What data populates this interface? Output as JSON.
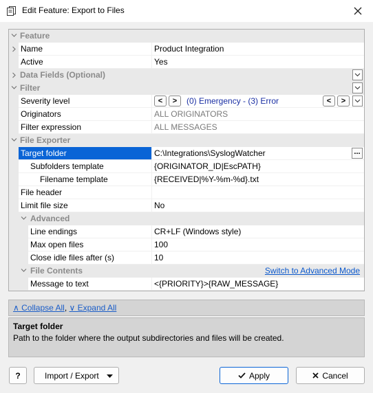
{
  "window": {
    "title": "Edit Feature: Export to Files"
  },
  "grid": {
    "cat_feature": "Feature",
    "name_label": "Name",
    "name_value": "Product Integration",
    "active_label": "Active",
    "active_value": "Yes",
    "cat_datafields": "Data Fields (Optional)",
    "cat_filter": "Filter",
    "severity_label": "Severity level",
    "severity_value": "(0) Emergency - (3) Error",
    "originators_label": "Originators",
    "originators_value": "ALL ORIGINATORS",
    "filterexpr_label": "Filter expression",
    "filterexpr_value": "ALL MESSAGES",
    "cat_fileexporter": "File Exporter",
    "target_label": "Target folder",
    "target_value": "C:\\Integrations\\SyslogWatcher",
    "subfolders_label": "Subfolders template",
    "subfolders_value": "{ORIGINATOR_ID|EscPATH}",
    "filename_label": "Filename template",
    "filename_value": "{RECEIVED|%Y-%m-%d}.txt",
    "fileheader_label": "File header",
    "fileheader_value": "",
    "limit_label": "Limit file size",
    "limit_value": "No",
    "cat_advanced": "Advanced",
    "lineendings_label": "Line endings",
    "lineendings_value": "CR+LF (Windows style)",
    "maxopen_label": "Max open files",
    "maxopen_value": "100",
    "closeidle_label": "Close idle files after (s)",
    "closeidle_value": "10",
    "cat_filecontents": "File Contents",
    "switch_link": "Switch to Advanced Mode",
    "msgtotext_label": "Message to text",
    "msgtotext_value": "<{PRIORITY}>{RAW_MESSAGE}",
    "ellipsis": "...",
    "nav_prev": "<",
    "nav_next": ">"
  },
  "expand_bar": {
    "collapse": "∧ Collapse All",
    "comma": ",",
    "expand": "∨ Expand All"
  },
  "description": {
    "title": "Target folder",
    "text": "Path to the folder where the output subdirectories and files will be created."
  },
  "footer": {
    "help": "?",
    "import_export": "Import / Export",
    "apply": "Apply",
    "cancel": "Cancel"
  },
  "colors": {
    "selection": "#0a64d6",
    "link": "#0b58cc",
    "value_blue": "#1a2fa3"
  }
}
